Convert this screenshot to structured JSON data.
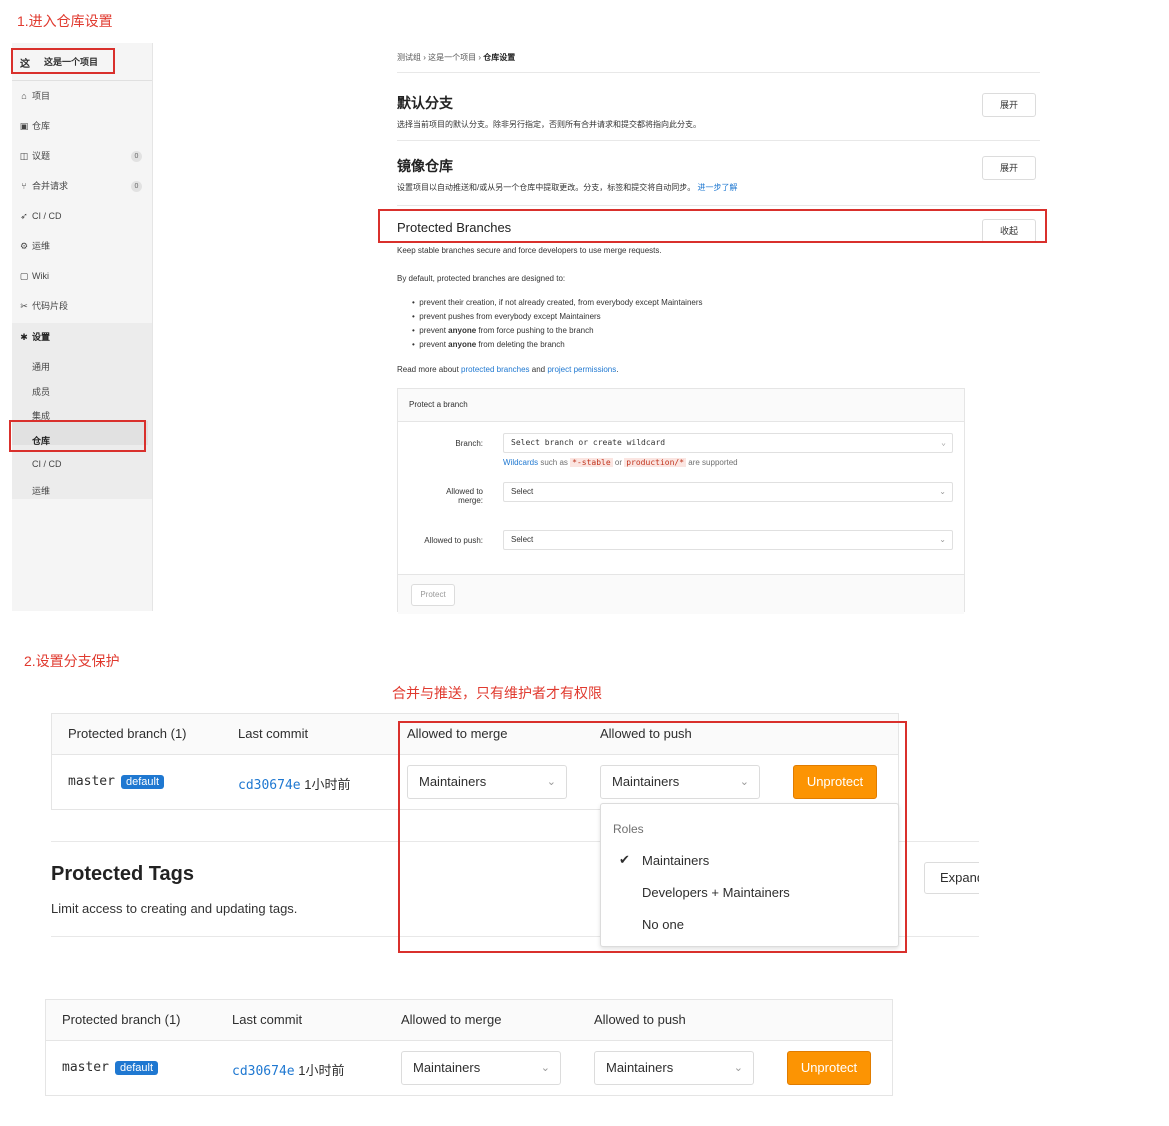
{
  "step1_heading": "1.进入仓库设置",
  "step2_heading": "2.设置分支保护",
  "annotation_note": "合并与推送，只有维护者才有权限",
  "sidebar": {
    "avatar_letter": "这",
    "project_name": "这是一个项目",
    "items": [
      {
        "icon": "home-icon",
        "label": "项目",
        "badge": ""
      },
      {
        "icon": "repo-icon",
        "label": "仓库",
        "badge": ""
      },
      {
        "icon": "issues-icon",
        "label": "议题",
        "badge": "0"
      },
      {
        "icon": "merge-request-icon",
        "label": "合并请求",
        "badge": "0"
      },
      {
        "icon": "rocket-icon",
        "label": "CI / CD",
        "badge": ""
      },
      {
        "icon": "operations-icon",
        "label": "运维",
        "badge": ""
      },
      {
        "icon": "book-icon",
        "label": "Wiki",
        "badge": ""
      },
      {
        "icon": "scissors-icon",
        "label": "代码片段",
        "badge": ""
      }
    ],
    "settings_label": "设置",
    "settings_sub": [
      "通用",
      "成员",
      "集成",
      "仓库",
      "CI / CD",
      "运维"
    ]
  },
  "breadcrumb": [
    "测试组",
    "这是一个项目",
    "仓库设置"
  ],
  "sections": {
    "default_branch": {
      "title": "默认分支",
      "desc": "选择当前项目的默认分支。除非另行指定，否则所有合并请求和提交都将指向此分支。",
      "button": "展开"
    },
    "mirror": {
      "title": "镜像仓库",
      "desc": "设置项目以自动推送和/或从另一个仓库中提取更改。分支，标签和提交将自动同步。",
      "link": "进一步了解",
      "button": "展开"
    },
    "protected": {
      "title": "Protected Branches",
      "button": "收起",
      "desc": "Keep stable branches secure and force developers to use merge requests."
    }
  },
  "protected_info": {
    "intro": "By default, protected branches are designed to:",
    "bullets": [
      {
        "pre": "prevent their creation, if not already created, from everybody except Maintainers",
        "bold": "",
        "post": ""
      },
      {
        "pre": "prevent pushes from everybody except Maintainers",
        "bold": "",
        "post": ""
      },
      {
        "pre": "prevent ",
        "bold": "anyone",
        "post": " from force pushing to the branch"
      },
      {
        "pre": "prevent ",
        "bold": "anyone",
        "post": " from deleting the branch"
      }
    ],
    "read_more_pre": "Read more about ",
    "link1": "protected branches",
    "and": " and ",
    "link2": "project permissions",
    "end": "."
  },
  "protect_form": {
    "header": "Protect a branch",
    "branch_label": "Branch:",
    "branch_placeholder": "Select branch or create wildcard",
    "hint_link": "Wildcards",
    "hint_a": " such as ",
    "hint_code1": "*-stable",
    "hint_or": " or ",
    "hint_code2": "production/*",
    "hint_end": " are supported",
    "merge_label_1": "Allowed to",
    "merge_label_2": "merge:",
    "merge_value": "Select",
    "push_label": "Allowed to push:",
    "push_value": "Select",
    "protect_button": "Protect"
  },
  "table_headers": {
    "branch": "Protected branch (1)",
    "commit": "Last commit",
    "merge": "Allowed to merge",
    "push": "Allowed to push"
  },
  "row": {
    "branch": "master",
    "badge": "default",
    "commit_sha": "cd30674e",
    "commit_time": "1小时前",
    "merge": "Maintainers",
    "push": "Maintainers",
    "unprotect": "Unprotect"
  },
  "dropdown": {
    "header": "Roles",
    "options": [
      {
        "label": "Maintainers",
        "checked": true
      },
      {
        "label": "Developers + Maintainers",
        "checked": false
      },
      {
        "label": "No one",
        "checked": false
      }
    ]
  },
  "protected_tags": {
    "title": "Protected Tags",
    "desc": "Limit access to creating and updating tags.",
    "button": "Expand"
  },
  "colors": {
    "accent": "#1f78d1",
    "warning": "#fc9403",
    "annotation": "#e03a2f"
  }
}
